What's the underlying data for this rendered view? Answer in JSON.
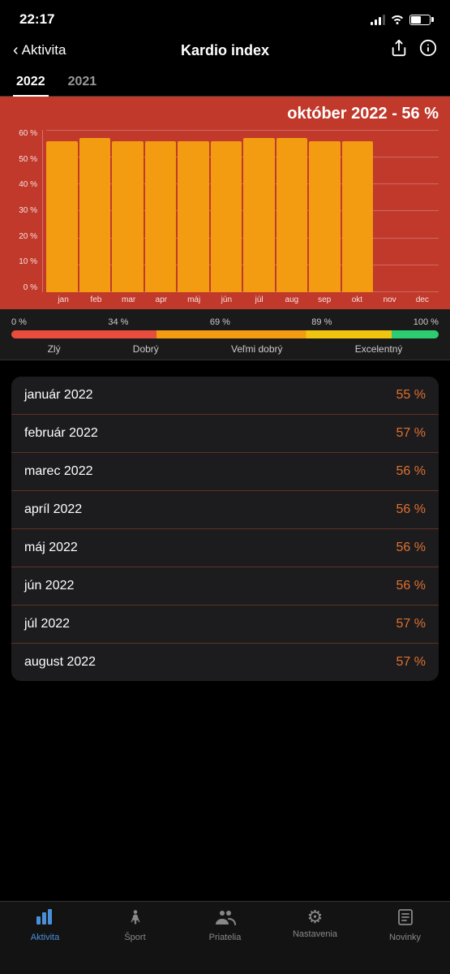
{
  "status": {
    "time": "22:17"
  },
  "nav": {
    "back_label": "Aktivita",
    "title": "Kardio index",
    "share_icon": "⬆",
    "info_icon": "ⓘ"
  },
  "year_tabs": [
    {
      "label": "2022",
      "active": true
    },
    {
      "label": "2021",
      "active": false
    }
  ],
  "chart": {
    "title": "október 2022 - 56 %",
    "y_labels": [
      "60 %",
      "50 %",
      "40 %",
      "30 %",
      "20 %",
      "10 %",
      "0 %"
    ],
    "x_labels": [
      "jan",
      "feb",
      "mar",
      "apr",
      "máj",
      "jún",
      "júl",
      "aug",
      "sep",
      "okt",
      "nov",
      "dec"
    ],
    "bars": [
      {
        "month": "jan",
        "value": 56,
        "height_pct": 93
      },
      {
        "month": "feb",
        "value": 57,
        "height_pct": 95
      },
      {
        "month": "mar",
        "value": 56,
        "height_pct": 93
      },
      {
        "month": "apr",
        "value": 56,
        "height_pct": 93
      },
      {
        "month": "máj",
        "value": 56,
        "height_pct": 93
      },
      {
        "month": "jún",
        "value": 56,
        "height_pct": 93
      },
      {
        "month": "júl",
        "value": 57,
        "height_pct": 95
      },
      {
        "month": "aug",
        "value": 57,
        "height_pct": 95
      },
      {
        "month": "sep",
        "value": 56,
        "height_pct": 93
      },
      {
        "month": "okt",
        "value": 56,
        "height_pct": 93
      },
      {
        "month": "nov",
        "value": 0,
        "height_pct": 0
      },
      {
        "month": "dec",
        "value": 0,
        "height_pct": 0
      }
    ],
    "bar_color": "#f39c12"
  },
  "color_scale": {
    "percentages": [
      "0 %",
      "34 %",
      "69 %",
      "89 %",
      "100 %"
    ],
    "labels": [
      "Zlý",
      "Dobrý",
      "Veľmi dobrý",
      "Excelentný"
    ]
  },
  "monthly_data": [
    {
      "name": "január 2022",
      "value": "55 %"
    },
    {
      "name": "február 2022",
      "value": "57 %"
    },
    {
      "name": "marec 2022",
      "value": "56 %"
    },
    {
      "name": "apríl 2022",
      "value": "56 %"
    },
    {
      "name": "máj 2022",
      "value": "56 %"
    },
    {
      "name": "jún 2022",
      "value": "56 %"
    },
    {
      "name": "júl 2022",
      "value": "57 %"
    },
    {
      "name": "august 2022",
      "value": "57 %"
    }
  ],
  "tab_bar": {
    "items": [
      {
        "label": "Aktivita",
        "icon": "📊",
        "active": true,
        "name": "aktivita"
      },
      {
        "label": "Šport",
        "icon": "🚶",
        "active": false,
        "name": "sport"
      },
      {
        "label": "Priatelia",
        "icon": "👥",
        "active": false,
        "name": "priatelia"
      },
      {
        "label": "Nastavenia",
        "icon": "⚙",
        "active": false,
        "name": "nastavenia"
      },
      {
        "label": "Novinky",
        "icon": "📋",
        "active": false,
        "name": "novinky"
      }
    ]
  }
}
